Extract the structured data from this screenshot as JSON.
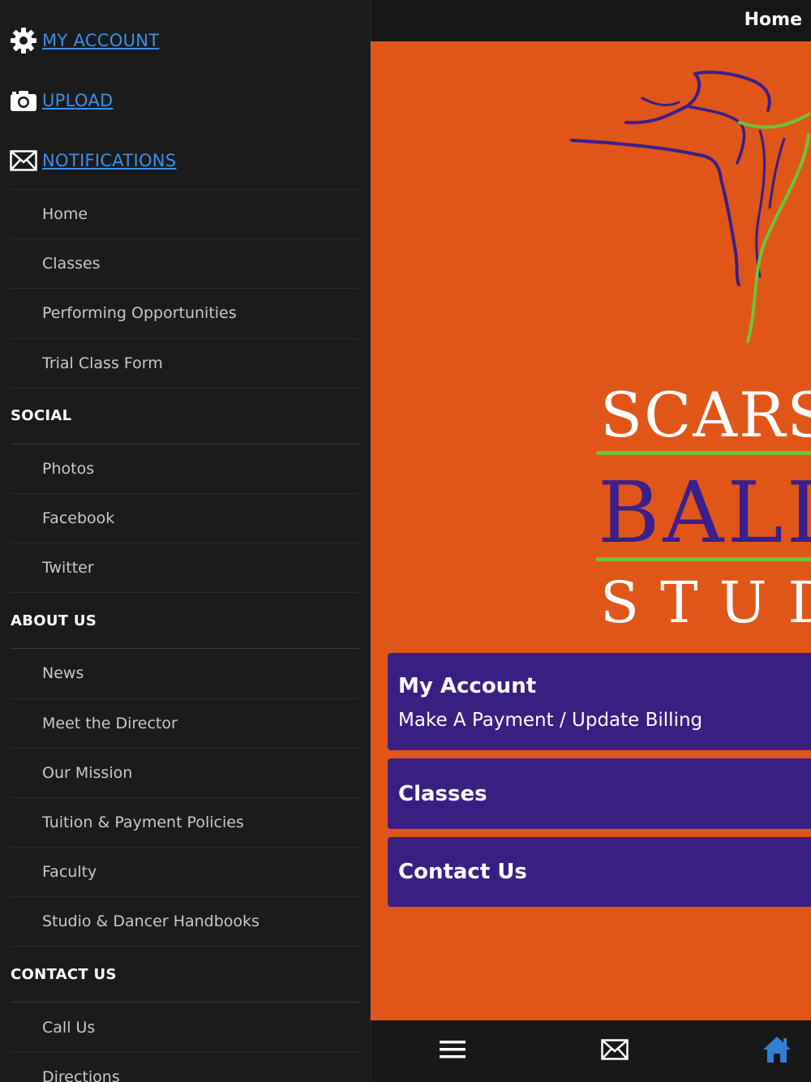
{
  "sidebar": {
    "top_links": [
      {
        "label": "MY ACCOUNT",
        "icon": "gear-icon"
      },
      {
        "label": "UPLOAD",
        "icon": "camera-icon"
      },
      {
        "label": "NOTIFICATIONS",
        "icon": "envelope-icon"
      }
    ],
    "menu": {
      "main_items": [
        "Home",
        "Classes",
        "Performing Opportunities",
        "Trial Class Form"
      ],
      "social": {
        "heading": "SOCIAL",
        "items": [
          "Photos",
          "Facebook",
          "Twitter"
        ]
      },
      "about": {
        "heading": "ABOUT US",
        "items": [
          "News",
          "Meet the Director",
          "Our Mission",
          "Tuition & Payment Policies",
          "Faculty",
          "Studio & Dancer Handbooks"
        ]
      },
      "contact": {
        "heading": "CONTACT US",
        "items": [
          "Call Us",
          "Directions"
        ]
      }
    }
  },
  "header": {
    "title": "Home"
  },
  "logo": {
    "line1": "SCARSD",
    "line2": "BALL",
    "line3": "STUD"
  },
  "cards": [
    {
      "title": "My Account",
      "subtitle": "Make A Payment / Update Billing"
    },
    {
      "title": "Classes"
    },
    {
      "title": "Contact Us"
    }
  ],
  "tabbar": {
    "items": [
      "menu-icon",
      "envelope-icon",
      "home-icon"
    ]
  },
  "colors": {
    "accent_link": "#3d8fe8",
    "hero_orange": "#e05619",
    "card_purple": "#3a1f83",
    "logo_green": "#6cc43b",
    "home_blue": "#2f7fd6"
  }
}
